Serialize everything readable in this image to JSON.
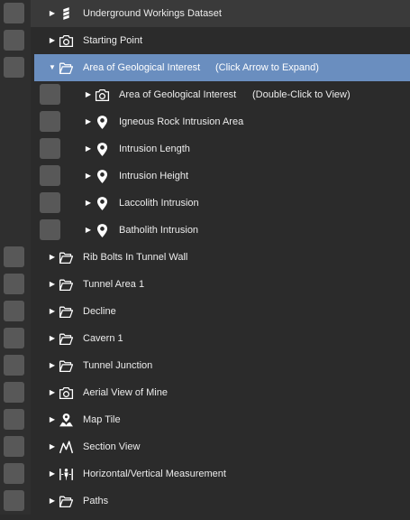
{
  "tree": {
    "items": [
      {
        "label": "Underground Workings Dataset",
        "icon": "layers-icon",
        "expanded": false,
        "visible_toggle": true
      },
      {
        "label": "Starting Point",
        "icon": "camera-icon",
        "expanded": false
      },
      {
        "label": "Area of Geological Interest",
        "hint": "(Click Arrow to Expand)",
        "icon": "folder-open-icon",
        "expanded": true,
        "selected": true
      },
      {
        "label": "Area of Geological Interest",
        "hint": "(Double-Click to View)",
        "icon": "camera-icon",
        "expanded": false
      },
      {
        "label": "Igneous Rock Intrusion Area",
        "icon": "map-pin-icon",
        "expanded": false
      },
      {
        "label": "Intrusion Length",
        "icon": "map-pin-icon",
        "expanded": false
      },
      {
        "label": "Intrusion Height",
        "icon": "map-pin-icon",
        "expanded": false
      },
      {
        "label": "Laccolith Intrusion",
        "icon": "map-pin-icon",
        "expanded": false
      },
      {
        "label": "Batholith Intrusion",
        "icon": "map-pin-icon",
        "expanded": false
      },
      {
        "label": "Rib Bolts In Tunnel Wall",
        "icon": "folder-open-icon",
        "expanded": false
      },
      {
        "label": "Tunnel Area 1",
        "icon": "folder-open-icon",
        "expanded": false
      },
      {
        "label": "Decline",
        "icon": "folder-open-icon",
        "expanded": false
      },
      {
        "label": "Cavern 1",
        "icon": "folder-open-icon",
        "expanded": false
      },
      {
        "label": "Tunnel Junction",
        "icon": "folder-open-icon",
        "expanded": false
      },
      {
        "label": "Aerial View of Mine",
        "icon": "camera-icon",
        "expanded": false
      },
      {
        "label": "Map Tile",
        "icon": "map-tile-icon",
        "expanded": false
      },
      {
        "label": "Section View",
        "icon": "section-view-icon",
        "expanded": false
      },
      {
        "label": "Horizontal/Vertical Measurement",
        "icon": "measurement-icon",
        "expanded": false
      },
      {
        "label": "Paths",
        "icon": "folder-open-icon",
        "expanded": false
      }
    ],
    "arrow_collapsed": "▶",
    "arrow_expanded": "▼"
  },
  "colors": {
    "background": "#2b2b2b",
    "selected_row": "#6a8ebf",
    "visibility_box": "#585858"
  }
}
